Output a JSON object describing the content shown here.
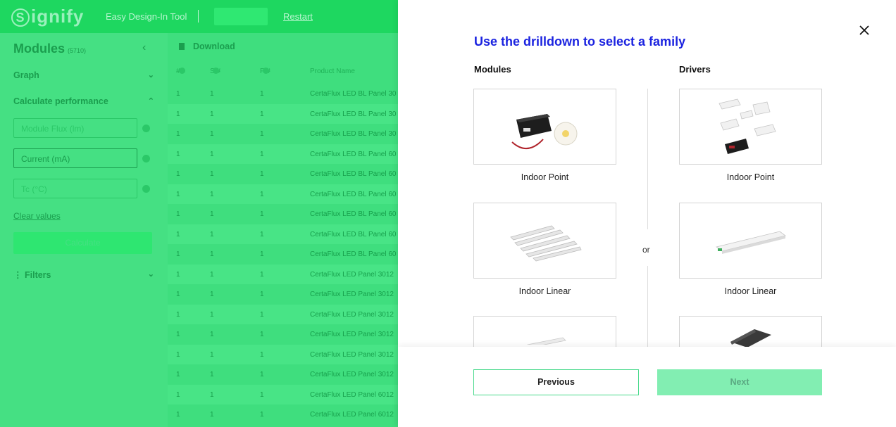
{
  "header": {
    "logo_text": "ignify",
    "logo_initial": "S",
    "tool_name": "Easy Design-In Tool",
    "primary_button": "",
    "restart_label": "Restart",
    "accent_color": "#1ed760"
  },
  "sidebar": {
    "title": "Modules",
    "count": "(5710)",
    "graph_label": "Graph",
    "calc_label": "Calculate performance",
    "inputs": [
      {
        "placeholder": "Module Flux (lm)"
      },
      {
        "placeholder": "Current (mA)"
      },
      {
        "placeholder": "Tc (°C)"
      }
    ],
    "clear_label": "Clear values",
    "calculate_label": "Calculate",
    "filters_label": "Filters"
  },
  "table": {
    "download_label": "Download",
    "headers": [
      "#",
      "S #",
      "P #",
      "Product Name"
    ],
    "rows": [
      [
        "1",
        "1",
        "1",
        "CertaFlux LED BL Panel 30"
      ],
      [
        "1",
        "1",
        "1",
        "CertaFlux LED BL Panel 30"
      ],
      [
        "1",
        "1",
        "1",
        "CertaFlux LED BL Panel 30"
      ],
      [
        "1",
        "1",
        "1",
        "CertaFlux LED BL Panel 60"
      ],
      [
        "1",
        "1",
        "1",
        "CertaFlux LED BL Panel 60"
      ],
      [
        "1",
        "1",
        "1",
        "CertaFlux LED BL Panel 60"
      ],
      [
        "1",
        "1",
        "1",
        "CertaFlux LED BL Panel 60"
      ],
      [
        "1",
        "1",
        "1",
        "CertaFlux LED BL Panel 60"
      ],
      [
        "1",
        "1",
        "1",
        "CertaFlux LED BL Panel 60"
      ],
      [
        "1",
        "1",
        "1",
        "CertaFlux LED Panel 3012"
      ],
      [
        "1",
        "1",
        "1",
        "CertaFlux LED Panel 3012"
      ],
      [
        "1",
        "1",
        "1",
        "CertaFlux LED Panel 3012"
      ],
      [
        "1",
        "1",
        "1",
        "CertaFlux LED Panel 3012"
      ],
      [
        "1",
        "1",
        "1",
        "CertaFlux LED Panel 3012"
      ],
      [
        "1",
        "1",
        "1",
        "CertaFlux LED Panel 3012"
      ],
      [
        "1",
        "1",
        "1",
        "CertaFlux LED Panel 6012"
      ],
      [
        "1",
        "1",
        "1",
        "CertaFlux LED Panel 6012"
      ]
    ]
  },
  "modal": {
    "title": "Use the drilldown to select a family",
    "modules_heading": "Modules",
    "drivers_heading": "Drivers",
    "or_label": "or",
    "modules": [
      {
        "label": "Indoor Point"
      },
      {
        "label": "Indoor Linear"
      },
      {
        "label": ""
      }
    ],
    "drivers": [
      {
        "label": "Indoor Point"
      },
      {
        "label": "Indoor Linear"
      },
      {
        "label": ""
      }
    ],
    "previous_label": "Previous",
    "next_label": "Next",
    "title_color": "#1b23e0"
  }
}
